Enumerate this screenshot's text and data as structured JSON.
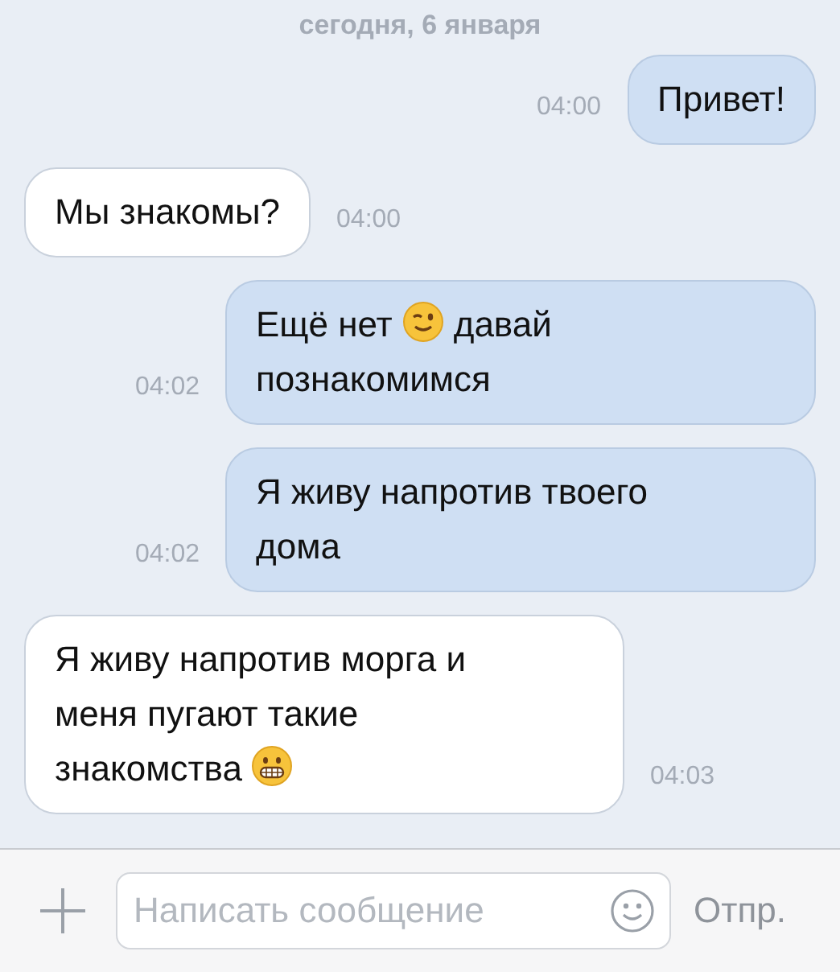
{
  "date": "сегодня, 6 января",
  "messages": [
    {
      "kind": "outgoing",
      "time": "04:00",
      "segments": [
        {
          "kind": "text",
          "text": "Привет!"
        }
      ]
    },
    {
      "kind": "incoming",
      "time": "04:00",
      "segments": [
        {
          "kind": "text",
          "text": "Мы знакомы?"
        }
      ]
    },
    {
      "kind": "outgoing",
      "time": "04:02",
      "segments": [
        {
          "kind": "text",
          "text": "Ещё нет"
        },
        {
          "kind": "wink"
        },
        {
          "kind": "text",
          "text": "давай"
        },
        {
          "kind": "break"
        },
        {
          "kind": "text",
          "text": "познакомимся"
        }
      ]
    },
    {
      "kind": "outgoing",
      "time": "04:02",
      "segments": [
        {
          "kind": "text",
          "text": "Я живу напротив твоего"
        },
        {
          "kind": "break"
        },
        {
          "kind": "text",
          "text": "дома"
        }
      ]
    },
    {
      "kind": "incoming",
      "time": "04:03",
      "segments": [
        {
          "kind": "text",
          "text": "Я живу напротив морга и"
        },
        {
          "kind": "break"
        },
        {
          "kind": "text",
          "text": "меня пугают такие"
        },
        {
          "kind": "break"
        },
        {
          "kind": "text",
          "text": "знакомства"
        },
        {
          "kind": "grimace"
        }
      ]
    }
  ],
  "composer": {
    "placeholder": "Написать сообщение",
    "send": "Отпр."
  }
}
